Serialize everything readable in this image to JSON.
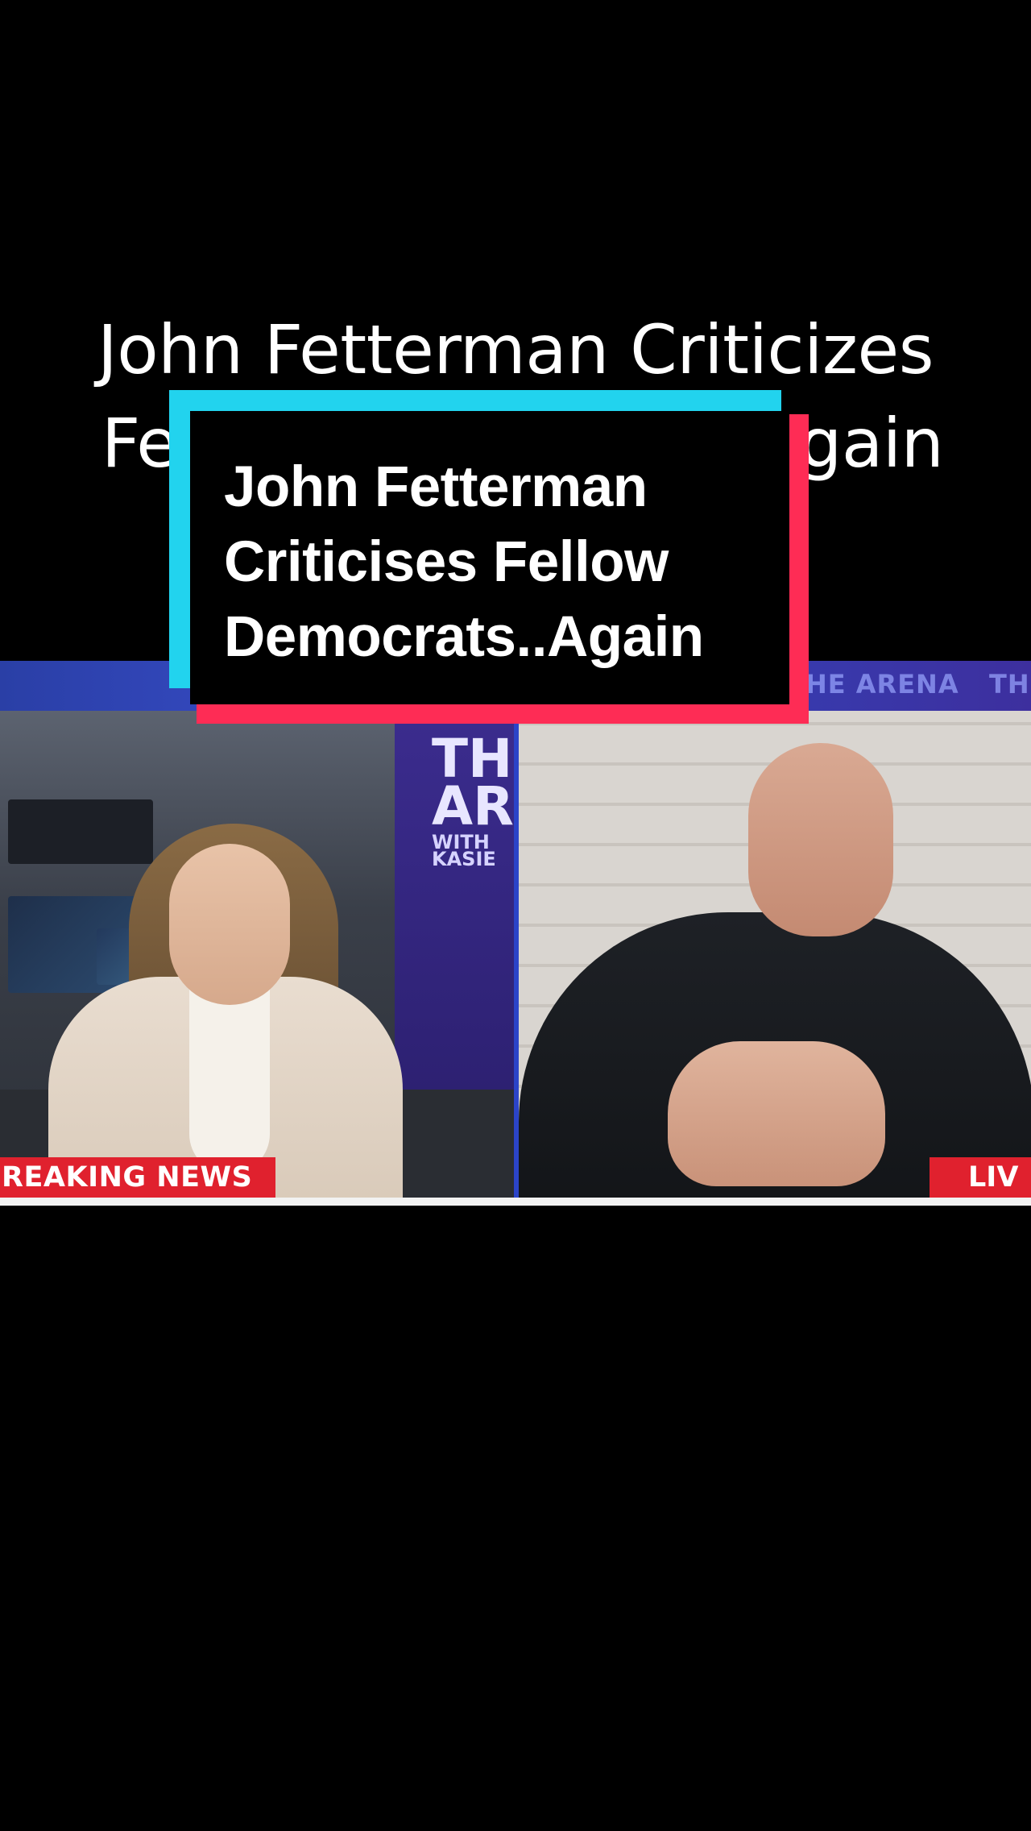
{
  "background_headline": {
    "line1": "John Fetterman Criticizes",
    "line2_left": "Fe",
    "line2_right": "gain"
  },
  "overlay_card": {
    "line1": "John Fetterman",
    "line2": "Criticises Fellow",
    "line3": "Democrats..Again"
  },
  "video": {
    "top_bar_text_a": "HE ARENA",
    "top_bar_text_b": "TH",
    "wall_logo_line1": "THE",
    "wall_logo_line2": "ARE",
    "wall_logo_line3": "WITH KASIE",
    "breaking_label": "REAKING NEWS",
    "live_label": "LIV"
  },
  "colors": {
    "cyan": "#22d3ee",
    "red": "#fe2c55",
    "news_red": "#e0212e",
    "bar_blue": "#3442b8"
  }
}
